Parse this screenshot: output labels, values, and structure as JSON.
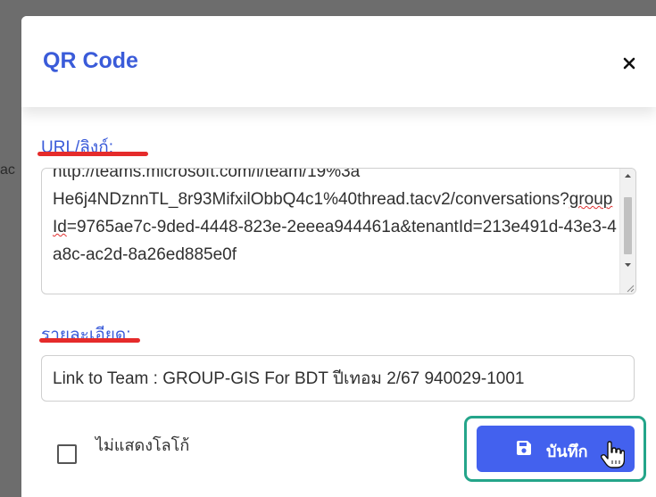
{
  "background": {
    "peek_text": "ac"
  },
  "modal": {
    "title": "QR Code",
    "close_symbol": "×",
    "url_field": {
      "label": "URL/ลิงก์:",
      "lines_before": "He6j4NDznnTL_8r93MifxilObbQ4c1%40thread.tacv2/conversations?",
      "misspelled": "groupId",
      "lines_after": "=9765ae7c-9ded-4448-823e-2eeea944461a&tenantId=213e491d-43e3-4a8c-ac2d-8a26ed885e0f"
    },
    "description_field": {
      "label": "รายละเอียด:",
      "value": "Link to Team : GROUP-GIS For BDT ปีเทอม 2/67 940029-1001"
    },
    "hide_logo": {
      "label": "ไม่แสดงโลโก้",
      "checked": false
    },
    "save_button": {
      "label": "บันทึก",
      "icon": "floppy-disk-icon"
    }
  },
  "colors": {
    "title": "#3a5bd9",
    "button": "#4361ee",
    "highlight": "#24a58a",
    "annotation": "#e52b2b"
  }
}
